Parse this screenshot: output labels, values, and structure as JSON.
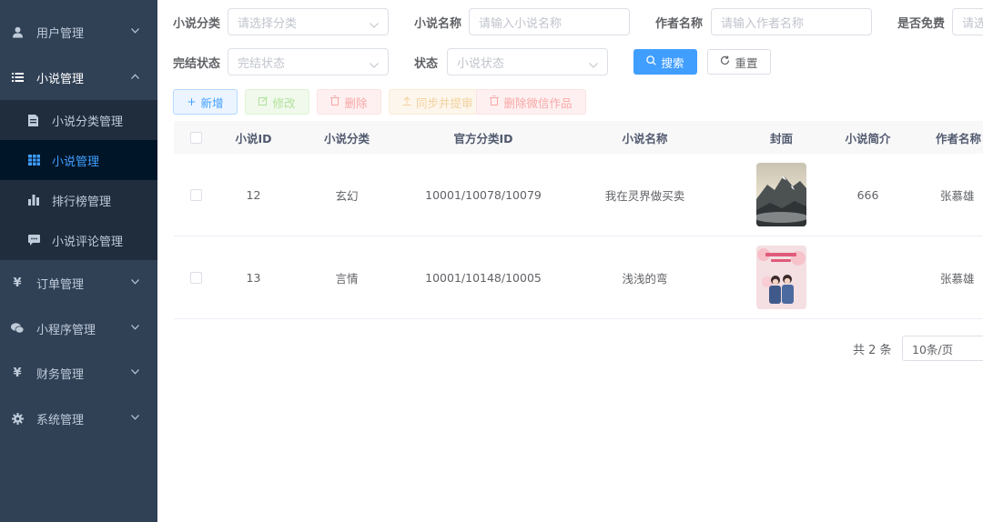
{
  "sidebar": {
    "menus": [
      {
        "label": "用户管理",
        "icon": "user-icon"
      },
      {
        "label": "小说管理",
        "icon": "list-icon"
      },
      {
        "label": "订单管理",
        "icon": "yen-icon"
      },
      {
        "label": "小程序管理",
        "icon": "wechat-icon"
      },
      {
        "label": "财务管理",
        "icon": "yen-icon"
      },
      {
        "label": "系统管理",
        "icon": "gear-icon"
      }
    ],
    "submenu": [
      {
        "label": "小说分类管理",
        "icon": "document-icon"
      },
      {
        "label": "小说管理",
        "icon": "table-icon"
      },
      {
        "label": "排行榜管理",
        "icon": "bar-chart-icon"
      },
      {
        "label": "小说评论管理",
        "icon": "comment-icon"
      }
    ],
    "active_sub": "小说管理"
  },
  "filters": {
    "category_label": "小说分类",
    "category_placeholder": "请选择分类",
    "name_label": "小说名称",
    "name_placeholder": "请输入小说名称",
    "author_label": "作者名称",
    "author_placeholder": "请输入作者名称",
    "free_label": "是否免费",
    "free_placeholder": "请选",
    "finish_label": "完结状态",
    "finish_placeholder": "完结状态",
    "status_label": "状态",
    "status_placeholder": "小说状态",
    "search_label": "搜索",
    "reset_label": "重置"
  },
  "toolbar": {
    "add_label": "新增",
    "edit_label": "修改",
    "delete_label": "删除",
    "sync_label": "同步并提审",
    "delete_wechat_label": "删除微信作品"
  },
  "table": {
    "headers": [
      "小说ID",
      "小说分类",
      "官方分类ID",
      "小说名称",
      "封面",
      "小说简介",
      "作者名称"
    ],
    "rows": [
      {
        "id": "12",
        "category": "玄幻",
        "official_id": "10001/10078/10079",
        "name": "我在灵界做买卖",
        "intro": "666",
        "author": "张慕雄"
      },
      {
        "id": "13",
        "category": "言情",
        "official_id": "10001/10148/10005",
        "name": "浅浅的弯",
        "intro": "",
        "author": "张慕雄"
      }
    ]
  },
  "pagination": {
    "total": "共 2 条",
    "page_size": "10条/页"
  },
  "colors": {
    "sidebar_bg": "#304156",
    "sidebar_active": "#409eff",
    "primary": "#409eff"
  }
}
